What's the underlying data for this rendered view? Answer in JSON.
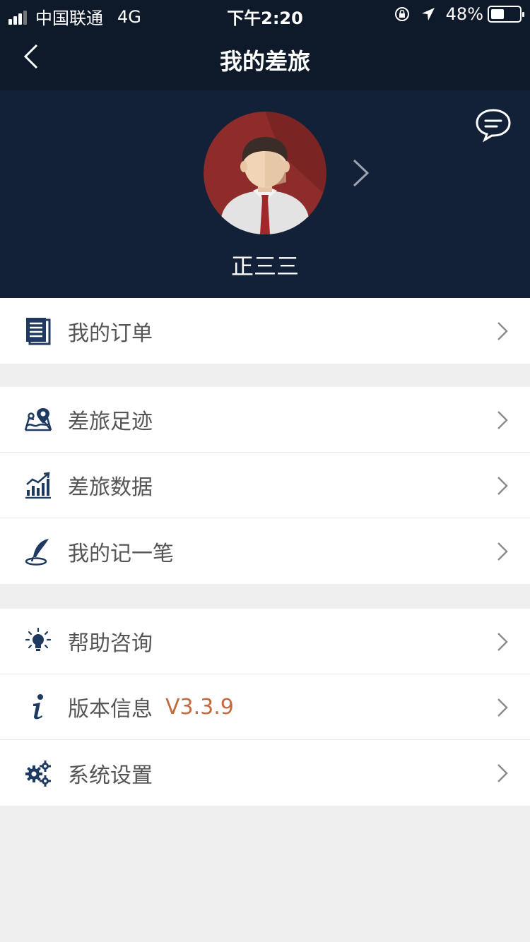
{
  "status_bar": {
    "carrier": "中国联通",
    "network": "4G",
    "time": "下午2:20",
    "battery": "48%",
    "battery_level": 0.48
  },
  "nav": {
    "title": "我的差旅",
    "back_icon": "chevron-left-icon"
  },
  "profile": {
    "name": "正三三",
    "message_icon": "chat-bubble-icon"
  },
  "menu_groups": [
    [
      {
        "label": "我的订单",
        "icon": "document-list-icon"
      }
    ],
    [
      {
        "label": "差旅足迹",
        "icon": "map-pin-icon"
      },
      {
        "label": "差旅数据",
        "icon": "bar-chart-icon"
      },
      {
        "label": "我的记一笔",
        "icon": "feather-pen-icon"
      }
    ],
    [
      {
        "label": "帮助咨询",
        "icon": "lightbulb-icon"
      },
      {
        "label": "版本信息",
        "icon": "info-icon",
        "extra": "V3.3.9"
      },
      {
        "label": "系统设置",
        "icon": "gears-icon"
      }
    ]
  ],
  "colors": {
    "header_bg": "#0e1a2a",
    "profile_bg": "#122038",
    "icon": "#1f3a60",
    "version_text": "#c36a3e"
  }
}
